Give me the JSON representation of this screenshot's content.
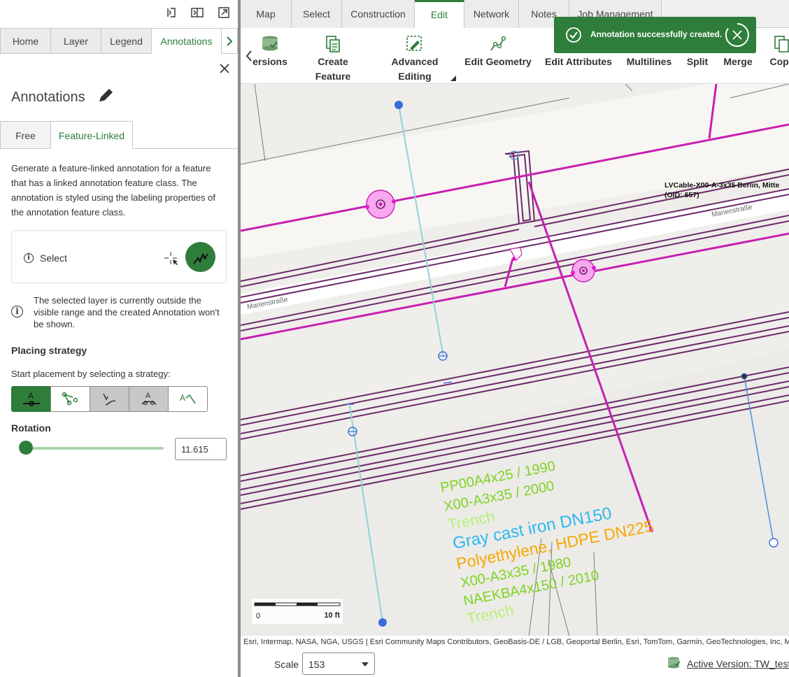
{
  "panel": {
    "tabs": [
      "Home",
      "Layer",
      "Legend",
      "Annotations"
    ],
    "title": "Annotations",
    "subtabs": [
      "Free",
      "Feature-Linked"
    ],
    "description": "Generate a feature-linked annotation for a feature that has a linked annotation feature class. The annotation is styled using the labeling properties of the annotation feature class.",
    "select_label": "Select",
    "warning": "The selected layer is currently outside the visible range and the created Annotation won't be shown.",
    "placing_title": "Placing strategy",
    "placing_label": "Start placement by selecting a strategy:",
    "strategies": [
      "horizontal-text-icon",
      "anchor-point-icon",
      "follow-curve-icon",
      "along-line-icon",
      "leader-text-icon"
    ],
    "rotation_label": "Rotation",
    "rotation_value": "11.615",
    "rotation_fraction": 0.03
  },
  "ribbon": {
    "tabs": [
      "Map",
      "Select",
      "Construction",
      "Edit",
      "Network",
      "Notes",
      "Job Management"
    ],
    "active_tab": "Edit",
    "tools": [
      {
        "label": "ersions",
        "icon": "versions-icon"
      },
      {
        "label": "Create Feature",
        "icon": "create-feature-icon"
      },
      {
        "label": "Advanced Editing",
        "icon": "advanced-editing-icon"
      },
      {
        "label": "Edit Geometry",
        "icon": "edit-geometry-icon"
      },
      {
        "label": "Edit Attributes",
        "icon": "edit-attributes-icon"
      },
      {
        "label": "Multilines",
        "icon": ""
      },
      {
        "label": "Split",
        "icon": ""
      },
      {
        "label": "Merge",
        "icon": ""
      },
      {
        "label": "Copy",
        "icon": "copy-icon"
      }
    ]
  },
  "toast": {
    "message": "Annotation successfully created."
  },
  "map": {
    "street_label": "Marienstraße",
    "cable_label": "LVCable-X00-A-3x35 Berlin, Mitte",
    "cable_oid": "(OID: 657)",
    "annotations": [
      {
        "text": "PP00A4x25 / 1990",
        "color": "#7ed321"
      },
      {
        "text": "X00-A3x35 / 2000",
        "color": "#7ed321"
      },
      {
        "text": "Trench",
        "color": "#b8f07a"
      },
      {
        "text": "Gray cast iron DN150",
        "color": "#2ab7f0"
      },
      {
        "text": "Polyethylene, HDPE DN225",
        "color": "#f5a800"
      },
      {
        "text": "X00-A3x35 / 1980",
        "color": "#7ed321"
      },
      {
        "text": "NAEKBA4x150 / 2010",
        "color": "#7ed321"
      },
      {
        "text": "Trench",
        "color": "#b8f07a"
      }
    ],
    "scale_zero": "0",
    "scale_max": "10 ft",
    "attribution": "Esri, Intermap, NASA, NGA, USGS | Esri Community Maps Contributors, GeoBasis-DE / LGB, Geoportal Berlin, Esri, TomTom, Garmin, GeoTechnologies, Inc, M"
  },
  "status": {
    "scale_label": "Scale",
    "scale_value": "153",
    "version": "Active Version: TW_test"
  },
  "colors": {
    "accent": "#2e7d3a",
    "cable": "#c81fb2",
    "duct": "#6b2a6a",
    "water": "#5aa0d8"
  }
}
